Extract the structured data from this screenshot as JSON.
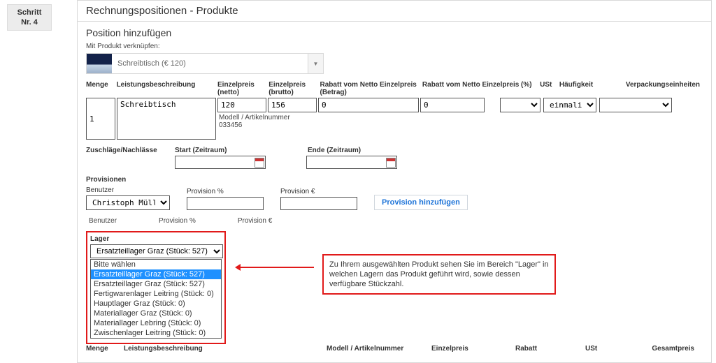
{
  "step": {
    "line1": "Schritt",
    "line2": "Nr. 4"
  },
  "panel_title": "Rechnungspositionen - Produkte",
  "section_title": "Position hinzufügen",
  "link_label": "Mit Produkt verknüpfen:",
  "product": {
    "name": "Schreibtisch (€ 120)"
  },
  "cols": {
    "menge": "Menge",
    "desc": "Leistungsbeschreibung",
    "upn": "Einzelpreis (netto)",
    "upb": "Einzelpreis (brutto)",
    "rabb": "Rabatt vom Netto Einzelpreis (Betrag)",
    "rabp": "Rabatt vom Netto Einzelpreis (%)",
    "ust": "USt",
    "freq": "Häufigkeit",
    "pack": "Verpackungseinheiten"
  },
  "vals": {
    "menge": "1",
    "desc": "Schreibtisch",
    "upn": "120",
    "upb": "156",
    "rabb": "0",
    "rabp": "0",
    "ust": "",
    "freq": "einmalig",
    "pack": ""
  },
  "model": {
    "label": "Modell / Artikelnummer",
    "value": "033456"
  },
  "row2": {
    "a": "Zuschläge/Nachlässe",
    "b": "Start (Zeitraum)",
    "c": "Ende (Zeitraum)"
  },
  "prov": {
    "title": "Provisionen",
    "user_label": "Benutzer",
    "user_value": "Christoph Müller",
    "pct_label": "Provision %",
    "eur_label": "Provision €",
    "add": "Provision hinzufügen"
  },
  "prov_list_head": {
    "user": "Benutzer",
    "pct": "Provision %",
    "eur": "Provision €"
  },
  "stock": {
    "label": "Lager",
    "selected": "Ersatzteillager Graz (Stück: 527)",
    "options": [
      "Bitte wählen",
      "Ersatzteillager Graz (Stück: 527)",
      "Ersatzteillager Graz (Stück: 527)",
      "Fertigwarenlager Leitring (Stück: 0)",
      "Hauptlager Graz (Stück: 0)",
      "Materiallager Graz (Stück: 0)",
      "Materiallager Lebring (Stück: 0)",
      "Zwischenlager Leitring (Stück: 0)"
    ]
  },
  "hint": "Zu Ihrem ausgewählten Produkt sehen Sie im Bereich \"Lager\" in welchen Lagern das Produkt geführt wird, sowie dessen verfügbare Stückzahl.",
  "summary": {
    "menge": "Menge",
    "desc": "Leistungsbeschreibung",
    "model": "Modell / Artikelnummer",
    "ep": "Einzelpreis",
    "rab": "Rabatt",
    "ust": "USt",
    "total": "Gesamtpreis"
  }
}
